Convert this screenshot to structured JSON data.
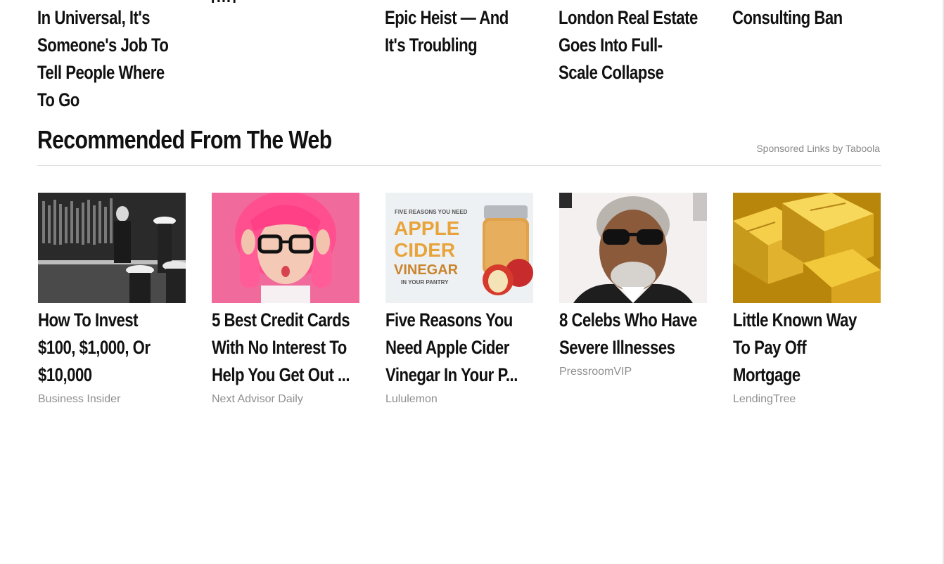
{
  "top_stories": [
    {
      "lines": [
        "In Universal, It's",
        "Someone's Job To",
        "Tell People Where",
        "To Go"
      ]
    },
    {
      "lines": [
        "[…]"
      ]
    },
    {
      "lines": [
        "Epic Heist — And",
        "It's Troubling"
      ]
    },
    {
      "lines": [
        "London Real Estate",
        "Goes Into Full-",
        "Scale Collapse"
      ]
    },
    {
      "lines": [
        "Consulting Ban"
      ]
    }
  ],
  "recommended": {
    "title": "Recommended From The Web",
    "sponsor_label": "Sponsored Links by Taboola",
    "items": [
      {
        "title_lines": [
          "How To Invest",
          "$100, $1,000, Or",
          "$10,000"
        ],
        "source": "Business Insider",
        "image": "stock-exchange-photo"
      },
      {
        "title_lines": [
          "5 Best Credit Cards",
          "With No Interest To",
          "Help You Get Out ..."
        ],
        "source": "Next Advisor Daily",
        "image": "pink-hair-woman-photo"
      },
      {
        "title_lines": [
          "Five Reasons You",
          "Need Apple Cider",
          "Vinegar In Your P..."
        ],
        "source": "Lululemon",
        "image": "apple-cider-vinegar-graphic",
        "image_text": {
          "kicker": "FIVE REASONS YOU NEED",
          "line1": "APPLE",
          "line2": "CIDER",
          "line3": "VINEGAR",
          "footer": "IN YOUR PANTRY"
        }
      },
      {
        "title_lines": [
          "8 Celebs Who Have",
          "Severe Illnesses"
        ],
        "source": "PressroomVIP",
        "image": "celebrity-sunglasses-photo"
      },
      {
        "title_lines": [
          "Little Known Way",
          "To Pay Off",
          "Mortgage"
        ],
        "source": "LendingTree",
        "image": "gold-bars-photo"
      }
    ]
  },
  "colors": {
    "accent_orange": "#e8a33a",
    "source_gray": "#8e8e8e",
    "divider": "#dcdcdc"
  }
}
